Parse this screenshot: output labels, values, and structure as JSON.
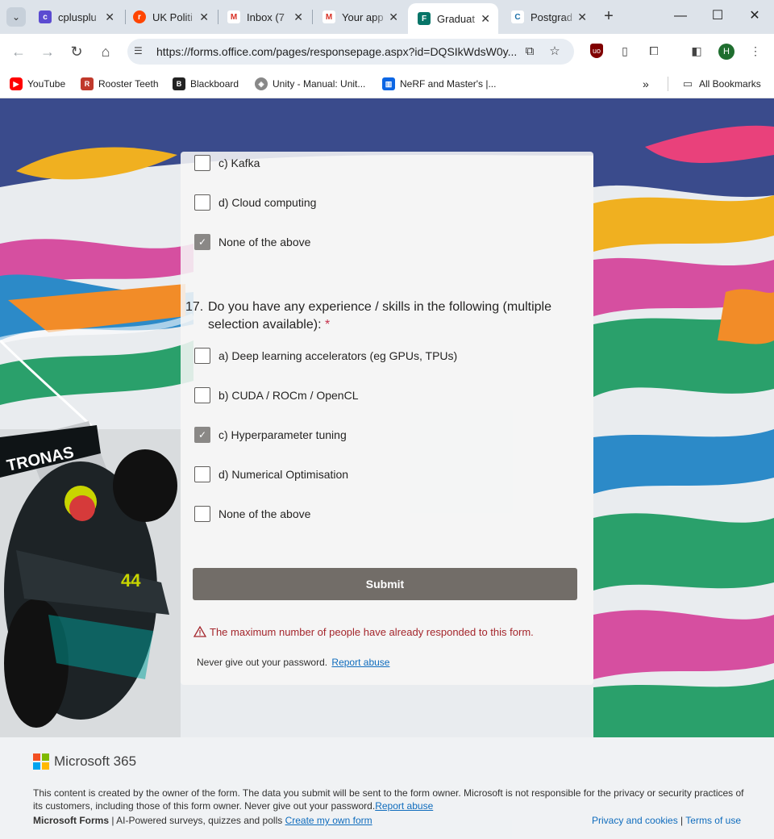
{
  "browser": {
    "tabs": [
      {
        "title": "cplusplu",
        "favicon_color": "#5b4bd1",
        "favicon": "c"
      },
      {
        "title": "UK Politi",
        "favicon_color": "#ff4500",
        "favicon": "r"
      },
      {
        "title": "Inbox (7",
        "favicon_color": "#ffffff",
        "favicon": "M"
      },
      {
        "title": "Your app",
        "favicon_color": "#ffffff",
        "favicon": "M"
      },
      {
        "title": "Graduat",
        "favicon_color": "#077568",
        "favicon": "F"
      },
      {
        "title": "Postgrad",
        "favicon_color": "#ffffff",
        "favicon": "C"
      }
    ],
    "url": "https://forms.office.com/pages/responsepage.aspx?id=DQSIkWdsW0y...",
    "profile_initial": "H",
    "bookmarks": [
      {
        "label": "YouTube",
        "icon": "youtube-icon"
      },
      {
        "label": "Rooster Teeth",
        "icon": "rooster-teeth-icon"
      },
      {
        "label": "Blackboard",
        "icon": "blackboard-icon"
      },
      {
        "label": "Unity - Manual: Unit...",
        "icon": "unity-icon"
      },
      {
        "label": "NeRF and Master's |...",
        "icon": "trello-icon"
      }
    ],
    "all_bookmarks": "All Bookmarks"
  },
  "form": {
    "prev_options": [
      {
        "label": "c)  Kafka",
        "checked": false
      },
      {
        "label": "d)  Cloud computing",
        "checked": false
      },
      {
        "label": "None of the above",
        "checked": true
      }
    ],
    "question": {
      "number": "17.",
      "text": "Do you have any experience / skills in the following (multiple selection available):",
      "required_mark": "*",
      "options": [
        {
          "label": "a)  Deep learning accelerators (eg GPUs, TPUs)",
          "checked": false
        },
        {
          "label": "b)  CUDA / ROCm / OpenCL",
          "checked": false
        },
        {
          "label": "c)  Hyperparameter tuning",
          "checked": true
        },
        {
          "label": "d)  Numerical Optimisation",
          "checked": false
        },
        {
          "label": "None of the above",
          "checked": false
        }
      ]
    },
    "submit_label": "Submit",
    "error_message": "The maximum number of people have already responded to this form.",
    "password_note": "Never give out your password.",
    "report_abuse": "Report abuse"
  },
  "footer": {
    "brand": "Microsoft 365",
    "disclaimer": "This content is created by the owner of the form. The data you submit will be sent to the form owner. Microsoft is not responsible for the privacy or security practices of its customers, including those of this form owner. Never give out your password.",
    "disclaimer_link": "Report abuse",
    "forms_name": "Microsoft Forms",
    "forms_tagline": " | AI-Powered surveys, quizzes and polls ",
    "create_link": "Create my own form",
    "privacy": "Privacy and cookies",
    "separator": " | ",
    "terms": "Terms of use"
  },
  "colors": {
    "accent_submit": "#726d68",
    "error": "#a4262c",
    "link": "#0f6cbd"
  }
}
